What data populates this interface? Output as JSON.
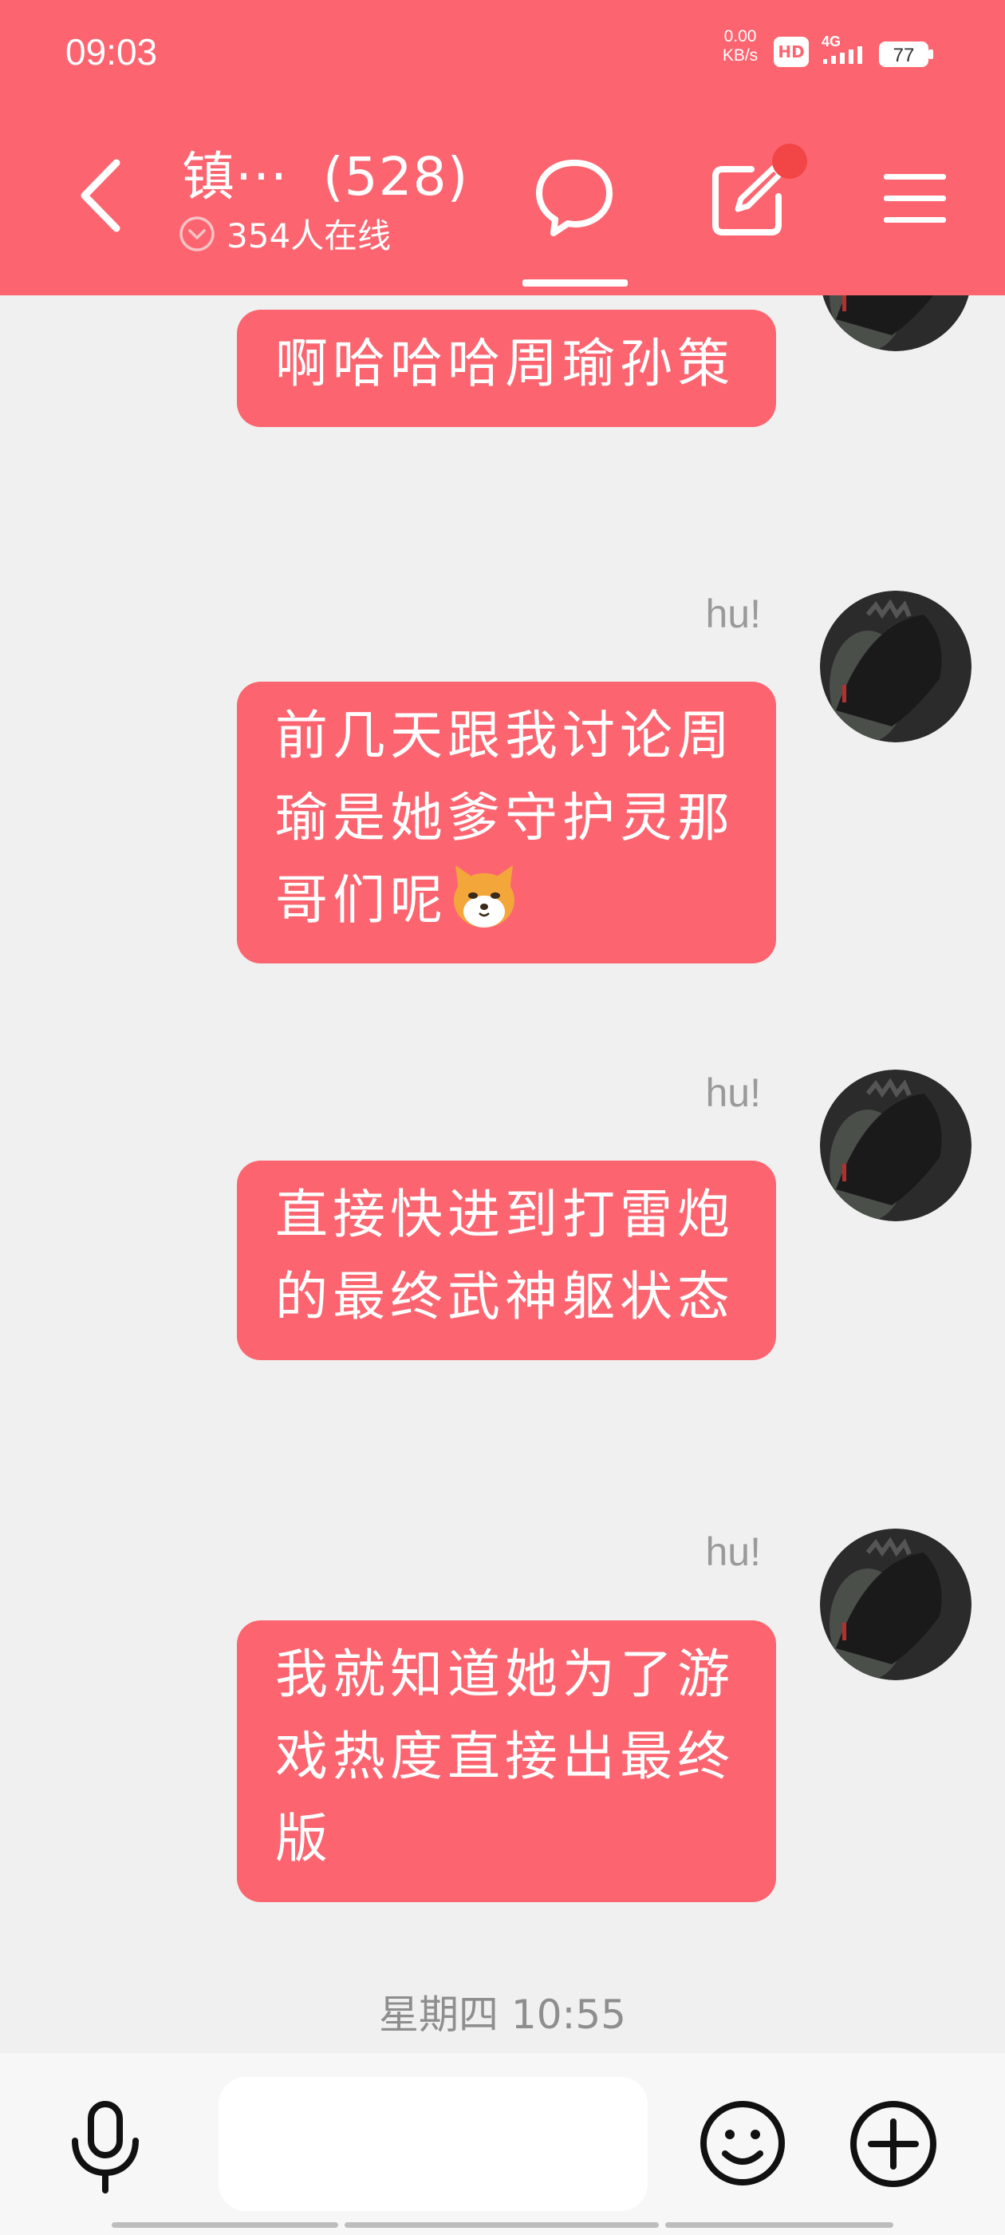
{
  "status_bar": {
    "time": "09:03",
    "net_speed_value": "0.00",
    "net_speed_unit": "KB/s",
    "hd": "HD",
    "network": "4G",
    "battery": "77"
  },
  "header": {
    "title": "镇···  (528)",
    "online": "354人在线",
    "active_tab": "chat-icon",
    "has_notification": true,
    "accent_color": "#fc6570"
  },
  "messages": [
    {
      "sender": "",
      "text": "啊哈哈哈周瑜孙策",
      "emoji": ""
    },
    {
      "sender": "hu!",
      "text": "前几天跟我讨论周瑜是她爹守护灵那哥们呢",
      "emoji": "shiba-dog-emoji"
    },
    {
      "sender": "hu!",
      "text": "直接快进到打雷炮的最终武神躯状态",
      "emoji": ""
    },
    {
      "sender": "hu!",
      "text": "我就知道她为了游戏热度直接出最终版",
      "emoji": ""
    }
  ],
  "timestamp": "星期四 10:55",
  "input": {
    "placeholder": ""
  }
}
